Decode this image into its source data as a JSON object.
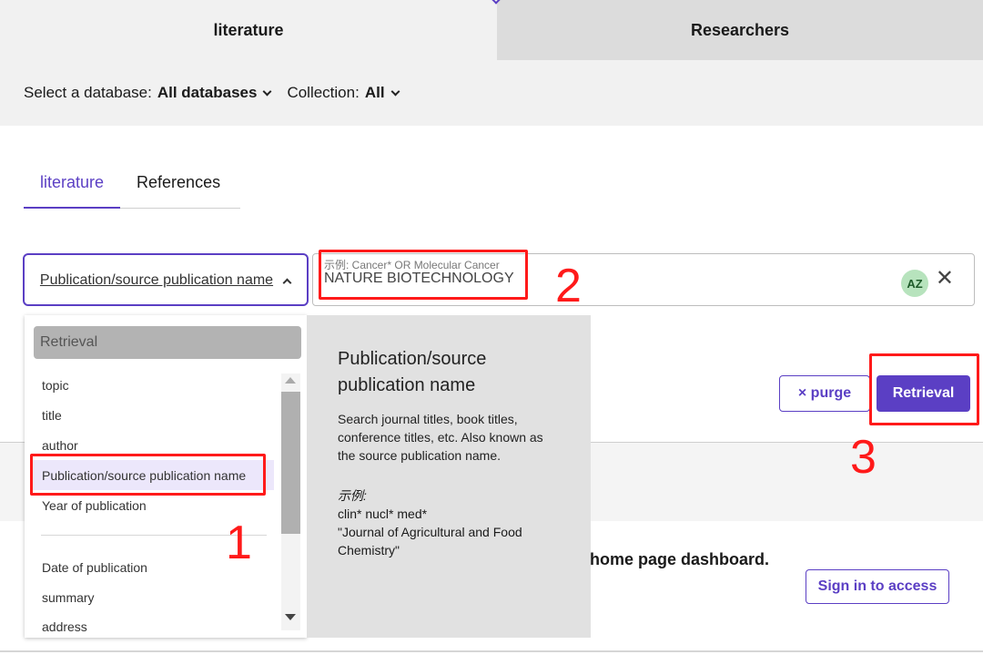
{
  "top_tabs": [
    {
      "label": "literature"
    },
    {
      "label": "Researchers"
    }
  ],
  "db_bar": {
    "database_label": "Select a database:",
    "database_value": "All databases",
    "collection_label": "Collection:",
    "collection_value": "All"
  },
  "sub_tabs": [
    {
      "label": "literature"
    },
    {
      "label": "References"
    }
  ],
  "search": {
    "field_label": "Publication/source publication name",
    "placeholder": "示例: Cancer* OR Molecular Cancer",
    "value": "NATURE BIOTECHNOLOGY",
    "az_label": "AZ",
    "clear_symbol": "✕"
  },
  "dropdown": {
    "header": "Retrieval",
    "items": [
      {
        "label": "topic"
      },
      {
        "label": "title"
      },
      {
        "label": "author"
      },
      {
        "label": "Publication/source publication name",
        "selected": true
      },
      {
        "label": "Year of publication"
      },
      {
        "label": "Date of publication"
      },
      {
        "label": "summary"
      },
      {
        "label": "address"
      }
    ]
  },
  "help": {
    "title": "Publication/source publication name",
    "description": "Search journal titles, book titles, conference titles, etc. Also known as the source publication name.",
    "example_heading": "示例:",
    "examples": [
      "clin* nucl* med*",
      "\"Journal of Agricultural and Food Chemistry\""
    ]
  },
  "actions": {
    "purge_label": "× purge",
    "retrieval_label": "Retrieval"
  },
  "dashboard": {
    "text": "home page dashboard.",
    "signin_label": "Sign in to access"
  },
  "annotations": [
    {
      "number": "1"
    },
    {
      "number": "2"
    },
    {
      "number": "3"
    }
  ],
  "colors": {
    "accent": "#5b3fc4",
    "annotation": "#ff1a1a"
  }
}
